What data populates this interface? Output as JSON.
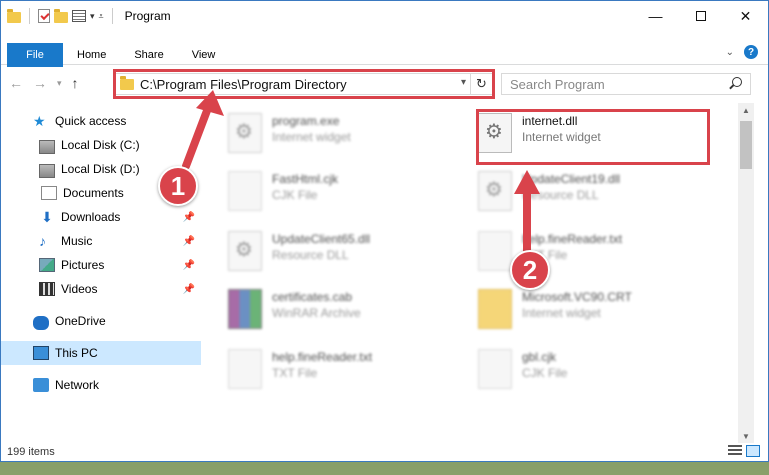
{
  "window": {
    "title": "Program",
    "controls": {
      "minimize": "—",
      "close": "✕"
    }
  },
  "ribbon": {
    "tabs": [
      "File",
      "Home",
      "Share",
      "View"
    ],
    "help": "?"
  },
  "nav": {
    "back": "←",
    "forward": "→",
    "up": "↑",
    "address": "C:\\Program Files\\Program Directory",
    "refresh": "↻",
    "search_placeholder": "Search Program"
  },
  "sidebar": {
    "items": [
      {
        "label": "Quick access"
      },
      {
        "label": "Local Disk (C:)"
      },
      {
        "label": "Local Disk (D:)"
      },
      {
        "label": "Documents"
      },
      {
        "label": "Downloads"
      },
      {
        "label": "Music"
      },
      {
        "label": "Pictures"
      },
      {
        "label": "Videos"
      },
      {
        "label": "OneDrive"
      },
      {
        "label": "This PC"
      },
      {
        "label": "Network"
      }
    ]
  },
  "files": [
    {
      "name": "program.exe",
      "type": "Internet widget"
    },
    {
      "name": "internet.dll",
      "type": "Internet widget"
    },
    {
      "name": "FastHtml.cjk",
      "type": "CJK File"
    },
    {
      "name": "UpdateClient19.dll",
      "type": "Resource DLL"
    },
    {
      "name": "UpdateClient65.dll",
      "type": "Resource DLL"
    },
    {
      "name": "help.fineReader.txt",
      "type": "TXT File"
    },
    {
      "name": "certificates.cab",
      "type": "WinRAR Archive"
    },
    {
      "name": "Microsoft.VC90.CRT",
      "type": "Internet widget"
    },
    {
      "name": "help.fineReader.txt",
      "type": "TXT File"
    },
    {
      "name": "gbl.cjk",
      "type": "CJK File"
    }
  ],
  "status": {
    "count": "199 items"
  },
  "annotations": {
    "step1": "1",
    "step2": "2",
    "color": "#d9434b"
  }
}
